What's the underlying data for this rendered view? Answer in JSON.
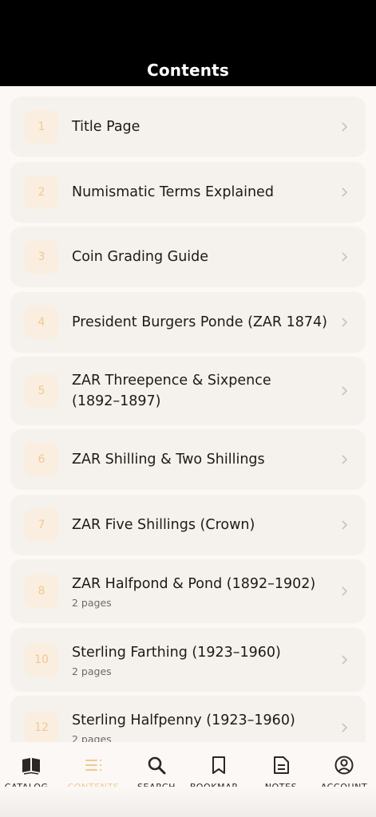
{
  "header": {
    "title": "Contents"
  },
  "colors": {
    "accent": "#f0c98e",
    "header_bg": "#000000",
    "card_bg": "#f5f1ed",
    "badge_bg": "#faeee0"
  },
  "items": [
    {
      "num": "1",
      "title": "Title Page",
      "subtitle": ""
    },
    {
      "num": "2",
      "title": "Numismatic Terms Explained",
      "subtitle": ""
    },
    {
      "num": "3",
      "title": "Coin Grading Guide",
      "subtitle": ""
    },
    {
      "num": "4",
      "title": "President Burgers Ponde (ZAR 1874)",
      "subtitle": ""
    },
    {
      "num": "5",
      "title": "ZAR Threepence & Sixpence (1892–1897)",
      "subtitle": ""
    },
    {
      "num": "6",
      "title": "ZAR Shilling & Two Shillings",
      "subtitle": ""
    },
    {
      "num": "7",
      "title": "ZAR Five Shillings (Crown)",
      "subtitle": ""
    },
    {
      "num": "8",
      "title": "ZAR Halfpond & Pond (1892–1902)",
      "subtitle": "2 pages"
    },
    {
      "num": "10",
      "title": "Sterling Farthing (1923–1960)",
      "subtitle": "2 pages"
    },
    {
      "num": "12",
      "title": "Sterling Halfpenny (1923–1960)",
      "subtitle": "2 pages"
    }
  ],
  "tabs": [
    {
      "label": "CATALOG…",
      "icon": "book-open-icon",
      "active": false
    },
    {
      "label": "CONTENTS",
      "icon": "list-icon",
      "active": true
    },
    {
      "label": "SEARCH",
      "icon": "search-icon",
      "active": false
    },
    {
      "label": "BOOKMAR…",
      "icon": "bookmark-icon",
      "active": false
    },
    {
      "label": "NOTES",
      "icon": "notes-icon",
      "active": false
    },
    {
      "label": "ACCOUNT",
      "icon": "account-icon",
      "active": false
    }
  ]
}
